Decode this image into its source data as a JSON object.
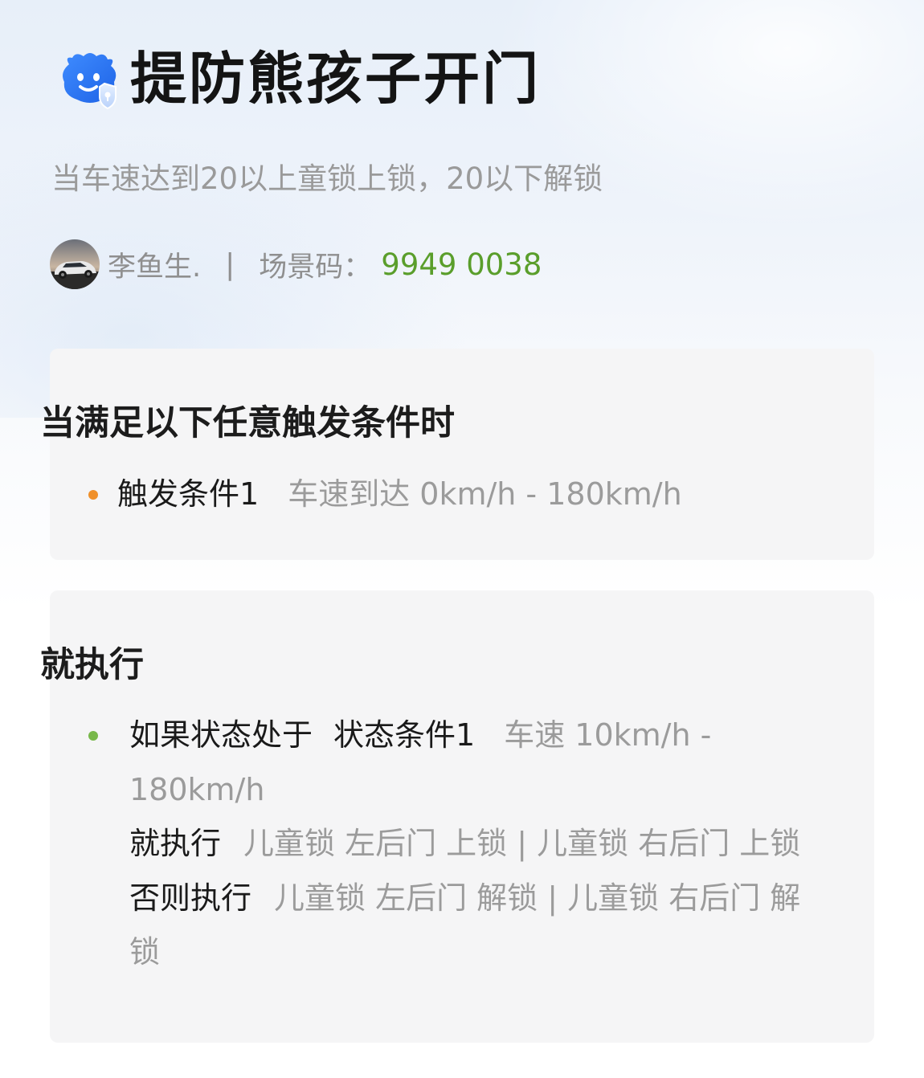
{
  "header": {
    "icon": "blue-smiling-mascot-with-shield-icon",
    "title": "提防熊孩子开门"
  },
  "description": "当车速达到20以上童锁上锁，20以下解锁",
  "author": {
    "avatar": "car-photo-avatar",
    "name": "李鱼生.",
    "separator": "|",
    "code_label": "场景码：",
    "code_value": "9949 0038"
  },
  "trigger_card": {
    "heading": "当满足以下任意触发条件时",
    "items": [
      {
        "label": "触发条件1",
        "detail": "车速到达 0km/h - 180km/h"
      }
    ]
  },
  "action_card": {
    "heading": "就执行",
    "condition_prefix": "如果状态处于",
    "condition_label": "状态条件1",
    "condition_detail_line1": "车速 10km/h -",
    "condition_detail_line2": "180km/h",
    "then_label": "就执行",
    "then_detail": "儿童锁 左后门 上锁 | 儿童锁 右后门 上锁",
    "else_label": "否则执行",
    "else_detail_line1": "儿童锁 左后门 解锁 | 儿童锁 右后门 解",
    "else_detail_line2": "锁"
  },
  "colors": {
    "code_value": "#5a9e2b",
    "trigger_bullet": "#f0902a",
    "action_bullet": "#78b84a",
    "card_background": "#f5f5f6",
    "mascot_blue": "#2f7df6"
  }
}
